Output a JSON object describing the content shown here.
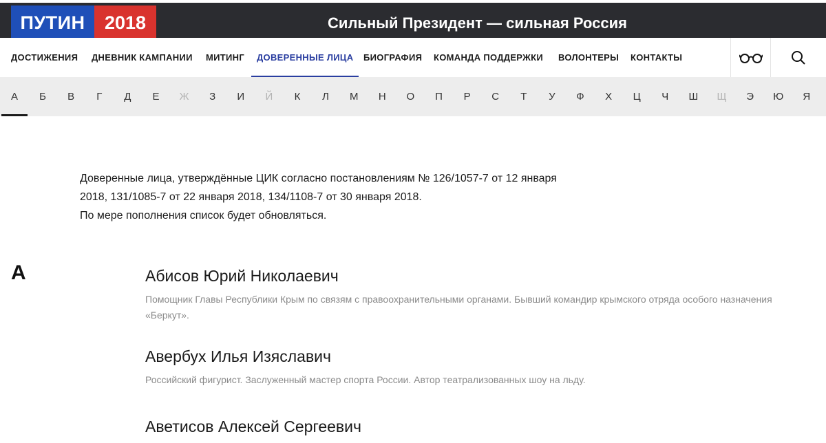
{
  "header": {
    "logo_word": "ПУТИН",
    "logo_year": "2018",
    "slogan": "Сильный Президент — сильная Россия",
    "colors": {
      "blue": "#1f4fb8",
      "red": "#d9332e",
      "bar": "#2b2c30",
      "active": "#2a3ea0"
    }
  },
  "nav": {
    "items": [
      {
        "label": "ДОСТИЖЕНИЯ"
      },
      {
        "label": "ДНЕВНИК КАМПАНИИ"
      },
      {
        "label": "МИТИНГ"
      },
      {
        "label": "ДОВЕРЕННЫЕ ЛИЦА",
        "active": true
      },
      {
        "label": "БИОГРАФИЯ"
      },
      {
        "label": "КОМАНДА ПОДДЕРЖКИ"
      },
      {
        "label": "ВОЛОНТЕРЫ"
      },
      {
        "label": "КОНТАКТЫ"
      }
    ],
    "icons": [
      "glasses-icon",
      "search-icon"
    ]
  },
  "alphabet": {
    "letters": [
      "А",
      "Б",
      "В",
      "Г",
      "Д",
      "Е",
      "Ж",
      "З",
      "И",
      "Й",
      "К",
      "Л",
      "М",
      "Н",
      "О",
      "П",
      "Р",
      "С",
      "Т",
      "У",
      "Ф",
      "Х",
      "Ц",
      "Ч",
      "Ш",
      "Щ",
      "Э",
      "Ю",
      "Я"
    ],
    "dim": [
      "Ж",
      "Й",
      "Щ"
    ],
    "selected": "А"
  },
  "intro": {
    "line1": "Доверенные лица, утверждённые ЦИК согласно постановлениям № 126/1057-7 от 12 января",
    "line2": "2018, 131/1085-7 от 22 января 2018, 134/1108-7 от 30 января 2018.",
    "line3": "По мере пополнения список будет обновляться."
  },
  "section": {
    "letter": "А",
    "people": [
      {
        "name": "Абисов Юрий Николаевич",
        "desc": "Помощник Главы Республики Крым по связям с правоохранительными органами. Бывший командир крымского отряда особого назначения «Беркут»."
      },
      {
        "name": "Авербух Илья Изяславич",
        "desc": "Российский фигурист. Заслуженный мастер спорта России. Автор театрализованных шоу на льду."
      },
      {
        "name": "Аветисов Алексей Сергеевич",
        "desc": ""
      }
    ]
  }
}
